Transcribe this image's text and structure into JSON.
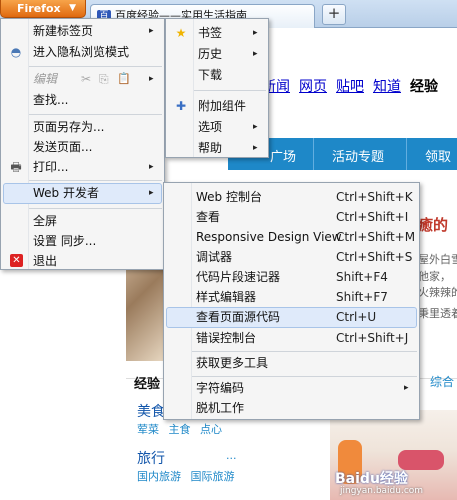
{
  "browser": {
    "app_button": "Firefox",
    "tab_title": "百度经验——实用生活指南",
    "favicon": "百",
    "new_tab": "+"
  },
  "page": {
    "nav": [
      "新闻",
      "网页",
      "贴吧",
      "知道",
      "经验"
    ],
    "nav_current": "经验",
    "blue_bar": [
      "广场",
      "活动专题",
      "领取"
    ],
    "headline": "癒的",
    "snippets": [
      "屋外白雪",
      "他家，",
      "火辣辣的",
      "秉里透着"
    ],
    "section_title": "经验",
    "section_right": "综合",
    "categories": [
      {
        "name": "美食",
        "subs": [
          "荤菜",
          "主食",
          "点心"
        ]
      },
      {
        "name": "旅行",
        "subs": [
          "国内旅游",
          "国际旅游"
        ]
      }
    ],
    "more": "···",
    "watermark": "Baidu经验",
    "watermark_sub": "jingyan.baidu.com"
  },
  "main_menu": {
    "items": [
      {
        "label": "新建标签页",
        "arrow": "▸",
        "icon": ""
      },
      {
        "label": "进入隐私浏览模式",
        "arrow": "",
        "icon": "mask-icon"
      },
      {
        "label": "编辑",
        "arrow": "▸",
        "icon": "",
        "disabled": true
      },
      {
        "label": "查找...",
        "arrow": "",
        "icon": ""
      },
      {
        "label": "页面另存为...",
        "arrow": "",
        "icon": ""
      },
      {
        "label": "发送页面...",
        "arrow": "",
        "icon": ""
      },
      {
        "label": "打印...",
        "arrow": "▸",
        "icon": "printer-icon"
      },
      {
        "label": "Web 开发者",
        "arrow": "▸",
        "icon": "",
        "highlighted": true
      },
      {
        "label": "全屏",
        "arrow": "",
        "icon": ""
      },
      {
        "label": "设置 同步...",
        "arrow": "",
        "icon": ""
      },
      {
        "label": "退出",
        "arrow": "",
        "icon": "exit-icon"
      }
    ],
    "edit_icons": [
      "✂",
      "⎘",
      "📋"
    ]
  },
  "side_menu": {
    "items": [
      {
        "label": "书签",
        "arrow": "▸",
        "icon": "star-icon"
      },
      {
        "label": "历史",
        "arrow": "▸",
        "icon": ""
      },
      {
        "label": "下载",
        "arrow": "",
        "icon": ""
      },
      {
        "label": "附加组件",
        "arrow": "",
        "icon": "puzzle-icon"
      },
      {
        "label": "选项",
        "arrow": "▸",
        "icon": ""
      },
      {
        "label": "帮助",
        "arrow": "▸",
        "icon": ""
      }
    ]
  },
  "dev_menu": {
    "items": [
      {
        "label": "Web 控制台",
        "shortcut": "Ctrl+Shift+K"
      },
      {
        "label": "查看",
        "shortcut": "Ctrl+Shift+I"
      },
      {
        "label": "Responsive Design View",
        "shortcut": "Ctrl+Shift+M"
      },
      {
        "label": "调试器",
        "shortcut": "Ctrl+Shift+S"
      },
      {
        "label": "代码片段速记器",
        "shortcut": "Shift+F4"
      },
      {
        "label": "样式编辑器",
        "shortcut": "Shift+F7"
      },
      {
        "label": "查看页面源代码",
        "shortcut": "Ctrl+U",
        "highlighted": true
      },
      {
        "label": "错误控制台",
        "shortcut": "Ctrl+Shift+J"
      },
      {
        "label": "获取更多工具",
        "shortcut": ""
      },
      {
        "label": "字符编码",
        "shortcut": "",
        "arrow": "▸"
      },
      {
        "label": "脱机工作",
        "shortcut": ""
      }
    ]
  },
  "colors": {
    "firefox_orange": "#e06a10",
    "menu_highlight": "#dfeafa",
    "baidu_blue": "#1e88c8"
  }
}
